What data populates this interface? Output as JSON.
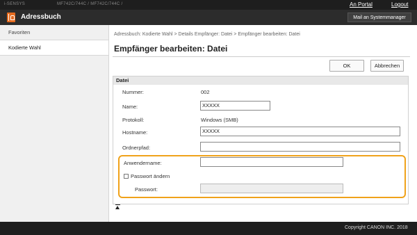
{
  "topbar": {
    "device": "i-SENSYS",
    "model": "MF742C/744C / MF742C/744C /",
    "portal": "An Portal",
    "logout": "Logout"
  },
  "header": {
    "title": "Adressbuch",
    "mail_button": "Mail an Systemmanager"
  },
  "sidebar": {
    "items": [
      {
        "label": "Favoriten"
      },
      {
        "label": "Kodierte Wahl"
      }
    ]
  },
  "main": {
    "breadcrumb": "Adressbuch: Kodierte Wahl > Details Empfänger: Datei > Empfänger bearbeiten: Datei",
    "title": "Empfänger bearbeiten: Datei",
    "ok_label": "OK",
    "cancel_label": "Abbrechen"
  },
  "panel": {
    "heading": "Datei",
    "number_label": "Nummer:",
    "number_value": "002",
    "name_label": "Name:",
    "name_value": "XXXXX",
    "protocol_label": "Protokoll:",
    "protocol_value": "Windows (SMB)",
    "hostname_label": "Hostname:",
    "hostname_value": "XXXXX",
    "folder_label": "Ordnerpfad:",
    "folder_value": "",
    "username_label": "Anwendername:",
    "username_value": "",
    "change_password_label": "Passwort ändern",
    "password_label": "Passwort:",
    "password_value": ""
  },
  "footer": {
    "copyright": "Copyright CANON INC. 2018"
  },
  "colors": {
    "accent": "#e56b1f",
    "highlight": "#f0a21a"
  }
}
